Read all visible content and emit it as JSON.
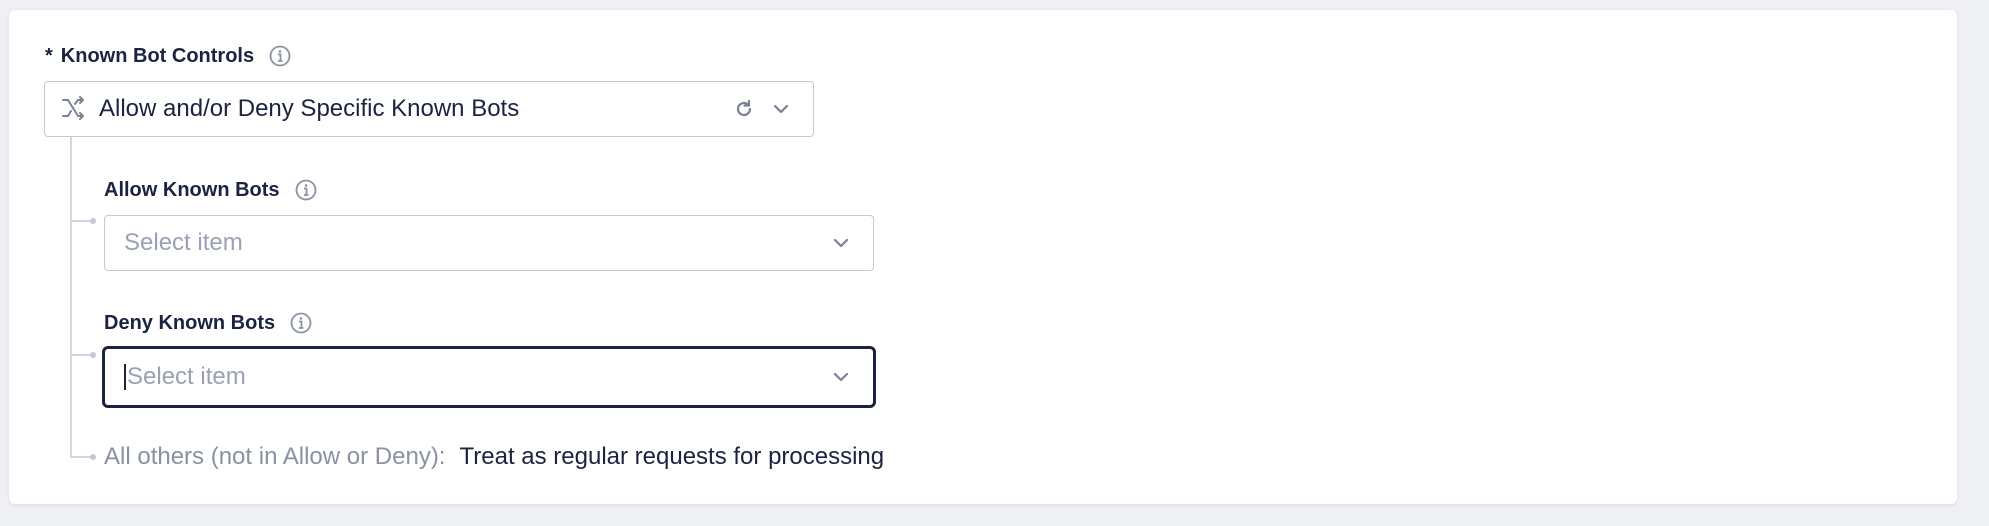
{
  "known_bot_controls": {
    "required_marker": "*",
    "label": "Known Bot Controls",
    "value": "Allow and/or Deny Specific Known Bots"
  },
  "allow_known_bots": {
    "label": "Allow Known Bots",
    "placeholder": "Select item"
  },
  "deny_known_bots": {
    "label": "Deny Known Bots",
    "placeholder": "Select item"
  },
  "all_others": {
    "label": "All others (not in Allow or Deny):",
    "value": "Treat as regular requests for processing"
  },
  "icons": {
    "info": "info-icon",
    "branch": "branch-icon",
    "reset": "reset-icon",
    "chevron": "chevron-down-icon"
  },
  "colors": {
    "text": "#1c2340",
    "placeholder": "#9aa1b2",
    "border": "#c4c9d6",
    "focus_border": "#1c2340",
    "muted": "#8a91a3"
  }
}
